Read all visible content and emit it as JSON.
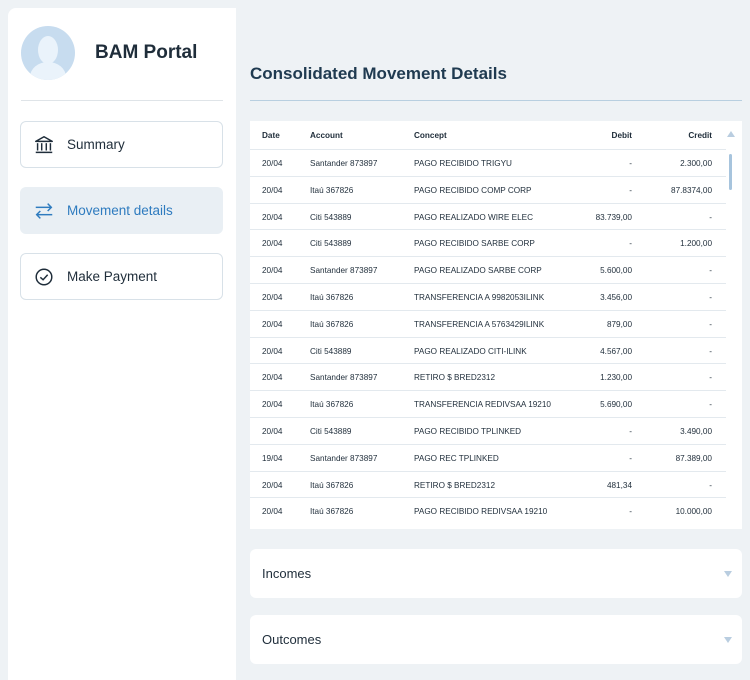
{
  "app": {
    "title": "BAM Portal"
  },
  "nav": {
    "items": [
      {
        "label": "Summary",
        "icon": "bank-icon",
        "active": false
      },
      {
        "label": "Movement details",
        "icon": "transfer-arrows-icon",
        "active": true
      },
      {
        "label": "Make Payment",
        "icon": "check-circle-icon",
        "active": false
      }
    ]
  },
  "main": {
    "title": "Consolidated Movement Details"
  },
  "table": {
    "headers": {
      "date": "Date",
      "account": "Account",
      "concept": "Concept",
      "debit": "Debit",
      "credit": "Credit"
    },
    "rows": [
      {
        "date": "20/04",
        "account": "Santander 873897",
        "concept": "PAGO RECIBIDO TRIGYU",
        "debit": "-",
        "credit": "2.300,00"
      },
      {
        "date": "20/04",
        "account": "Itaú 367826",
        "concept": "PAGO RECIBIDO COMP CORP",
        "debit": "-",
        "credit": "87.8374,00"
      },
      {
        "date": "20/04",
        "account": "Citi 543889",
        "concept": "PAGO REALIZADO WIRE ELEC",
        "debit": "83.739,00",
        "credit": "-"
      },
      {
        "date": "20/04",
        "account": "Citi 543889",
        "concept": "PAGO RECIBIDO SARBE CORP",
        "debit": "-",
        "credit": "1.200,00"
      },
      {
        "date": "20/04",
        "account": "Santander 873897",
        "concept": "PAGO REALIZADO SARBE CORP",
        "debit": "5.600,00",
        "credit": "-"
      },
      {
        "date": "20/04",
        "account": "Itaú 367826",
        "concept": "TRANSFERENCIA A 9982053ILINK",
        "debit": "3.456,00",
        "credit": "-"
      },
      {
        "date": "20/04",
        "account": "Itaú 367826",
        "concept": "TRANSFERENCIA A 5763429ILINK",
        "debit": "879,00",
        "credit": "-"
      },
      {
        "date": "20/04",
        "account": "Citi 543889",
        "concept": "PAGO REALIZADO CITI-ILINK",
        "debit": "4.567,00",
        "credit": "-"
      },
      {
        "date": "20/04",
        "account": "Santander 873897",
        "concept": "RETIRO      $ BRED2312",
        "debit": "1.230,00",
        "credit": "-"
      },
      {
        "date": "20/04",
        "account": "Itaú 367826",
        "concept": "TRANSFERENCIA REDIVSAA 19210",
        "debit": "5.690,00",
        "credit": "-"
      },
      {
        "date": "20/04",
        "account": "Citi 543889",
        "concept": "PAGO RECIBIDO TPLINKED",
        "debit": "-",
        "credit": "3.490,00"
      },
      {
        "date": "19/04",
        "account": "Santander 873897",
        "concept": "PAGO REC TPLINKED",
        "debit": "-",
        "credit": "87.389,00"
      },
      {
        "date": "20/04",
        "account": "Itaú 367826",
        "concept": "RETIRO      $ BRED2312",
        "debit": "481,34",
        "credit": "-"
      },
      {
        "date": "20/04",
        "account": "Itaú 367826",
        "concept": "PAGO RECIBIDO REDIVSAA 19210",
        "debit": "-",
        "credit": "10.000,00"
      }
    ]
  },
  "sections": {
    "incomes": {
      "label": "Incomes"
    },
    "outcomes": {
      "label": "Outcomes"
    }
  },
  "colors": {
    "accent": "#2e7bbf",
    "background": "#eef2f5",
    "active_nav": "#e9eff4"
  }
}
